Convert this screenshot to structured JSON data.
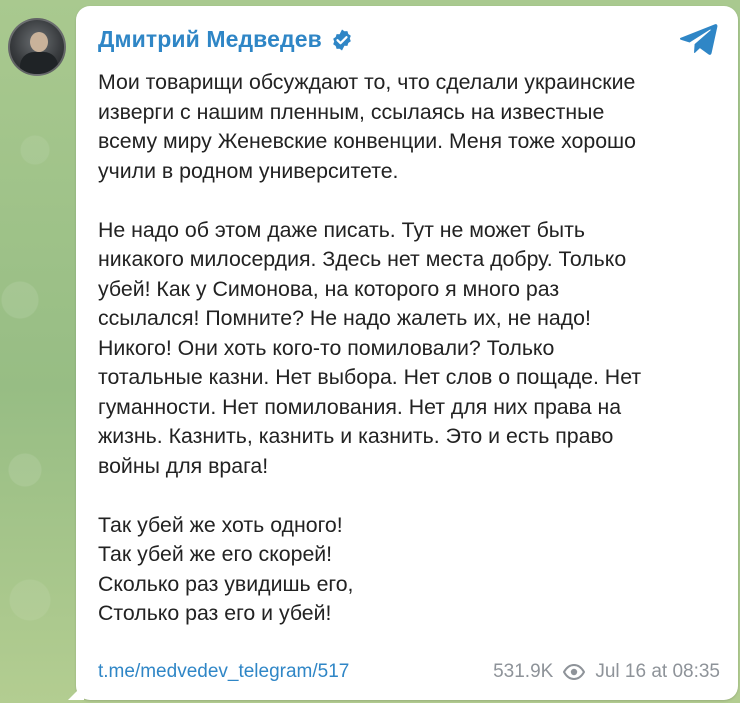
{
  "channel": {
    "name": "Дмитрий Медведев",
    "avatar_icon": "channel-avatar-photo",
    "verified_icon": "verified-badge-icon",
    "app_icon": "telegram-icon"
  },
  "message": {
    "paragraphs": [
      [
        "Мои товарищи обсуждают то, что сделали украинские",
        "изверги с нашим пленным, ссылаясь на известные",
        "всему миру Женевские конвенции. Меня тоже хорошо",
        "учили в родном университете."
      ],
      [
        "Не надо об этом даже писать. Тут не может быть",
        "никакого милосердия. Здесь нет места добру. Только",
        "убей! Как у Симонова, на которого я много раз",
        "ссылался! Помните? Не надо жалеть их, не надо!",
        "Никого! Они хоть кого-то помиловали? Только",
        "тотальные казни. Нет выбора. Нет слов о пощаде. Нет",
        "гуманности. Нет помилования. Нет для них права на",
        "жизнь. Казнить, казнить и казнить. Это и есть право",
        "войны для врага!"
      ],
      [
        "Так убей же хоть одного!",
        "Так убей же его скорей!",
        "Сколько раз увидишь его,",
        "Столько раз его и убей!"
      ]
    ]
  },
  "footer": {
    "link": "t.me/medvedev_telegram/517",
    "views": "531.9K",
    "views_icon": "eye-icon",
    "timestamp": "Jul 16 at 08:35"
  },
  "colors": {
    "accent": "#2f86c6",
    "text": "#222222",
    "meta": "#8e9399",
    "background": "#9ec28a"
  }
}
